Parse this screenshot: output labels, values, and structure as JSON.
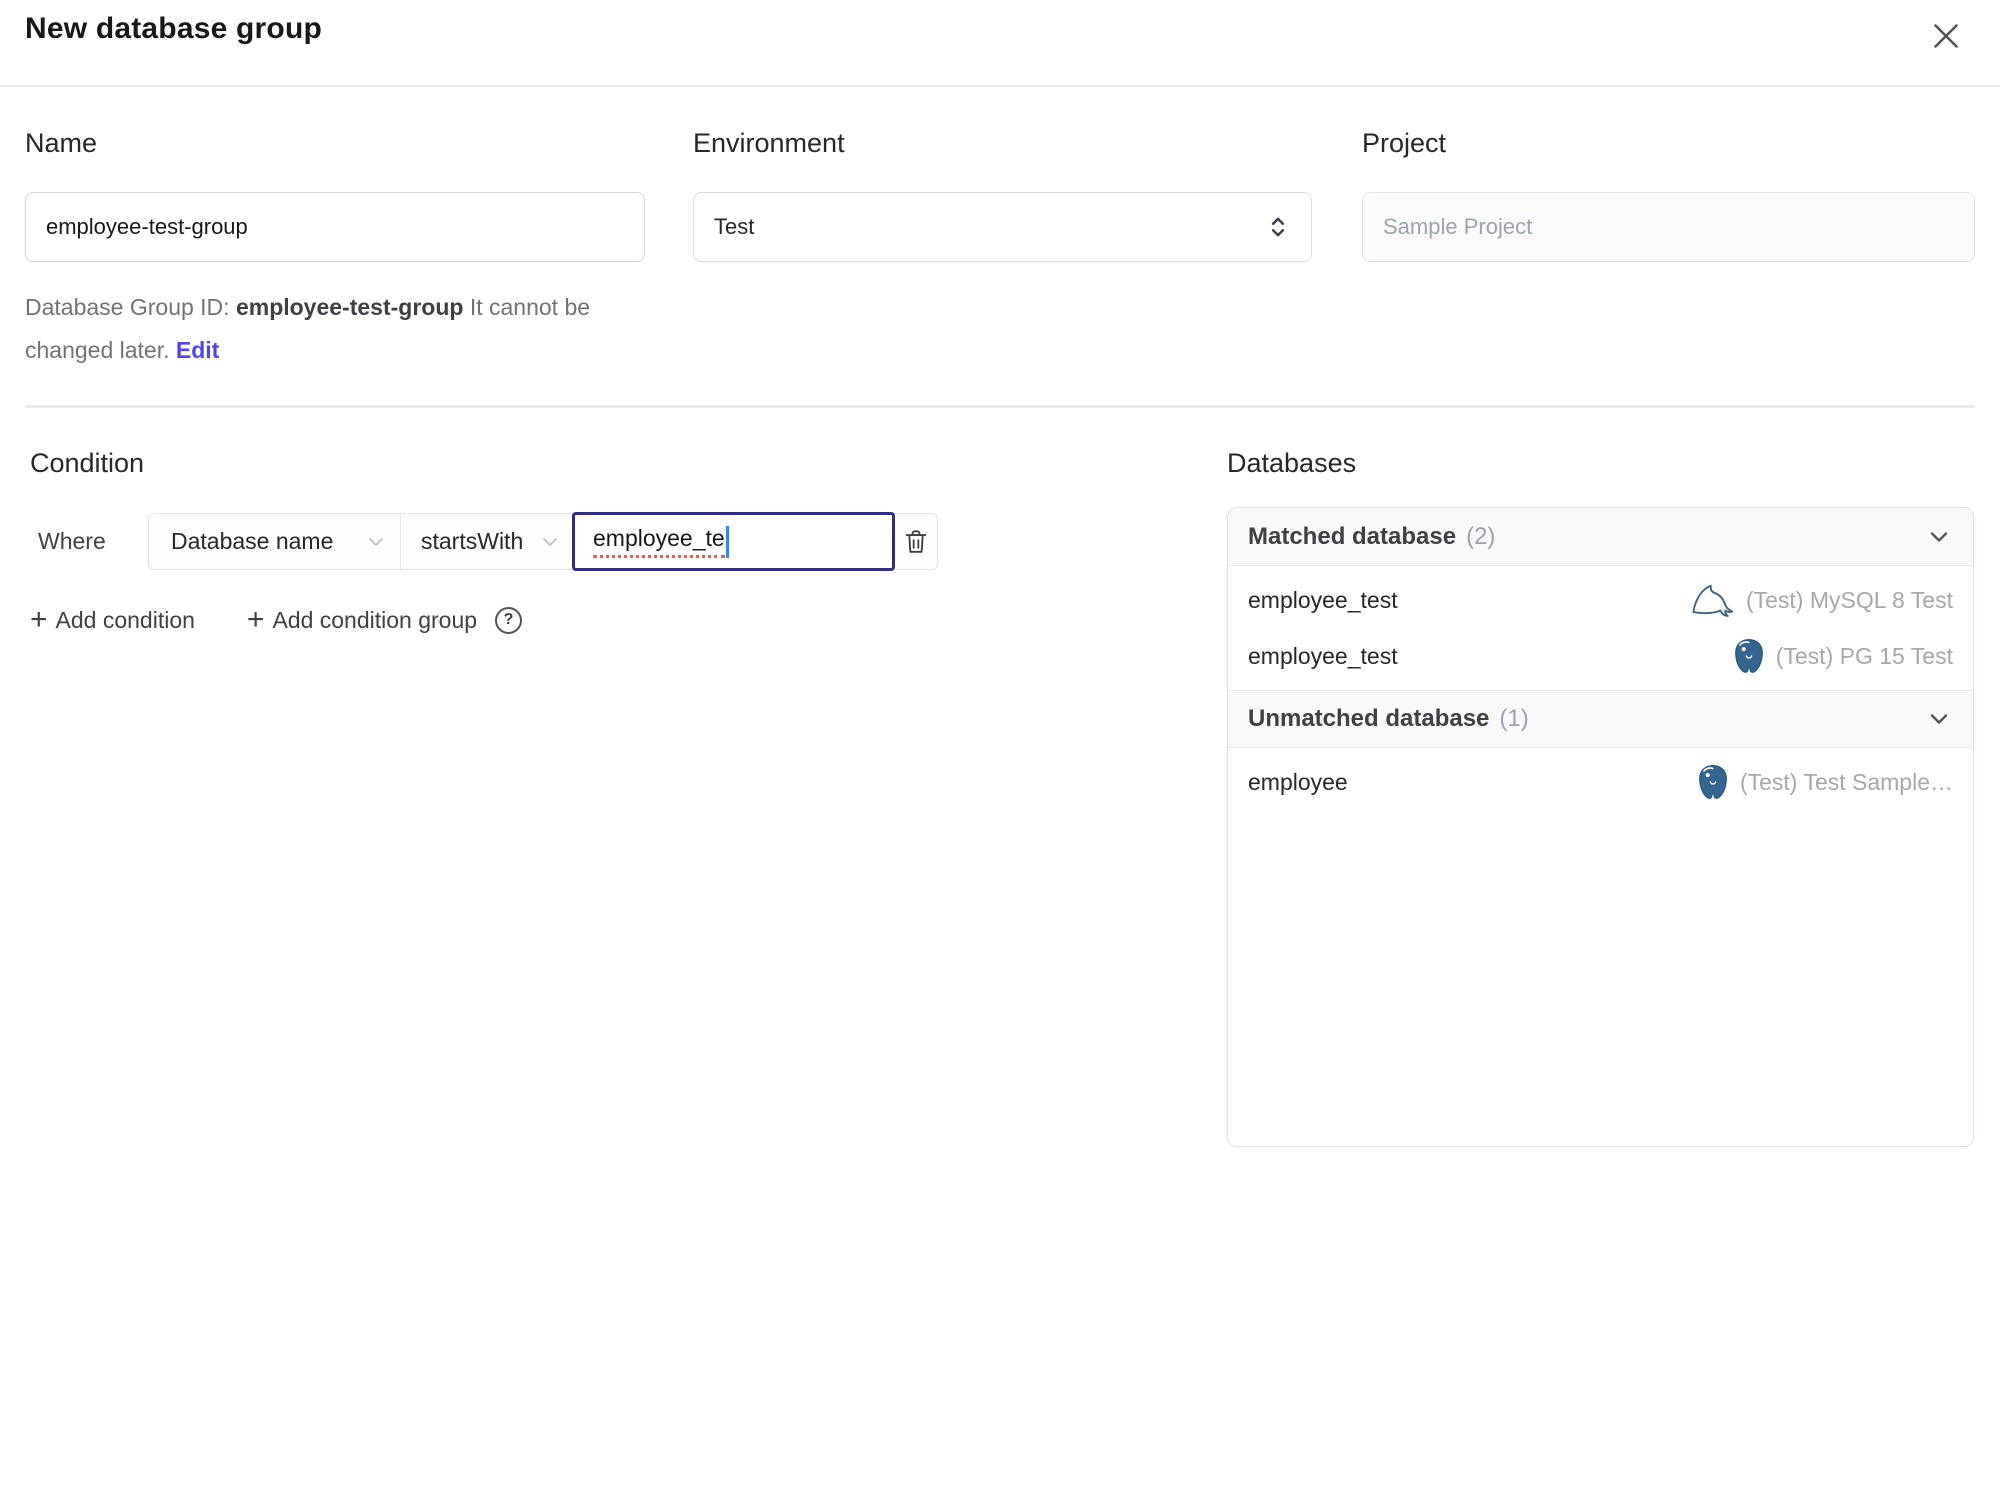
{
  "dialog": {
    "title": "New database group"
  },
  "form": {
    "name": {
      "label": "Name",
      "value": "employee-test-group"
    },
    "environment": {
      "label": "Environment",
      "value": "Test"
    },
    "project": {
      "label": "Project",
      "value": "Sample Project"
    },
    "id_note": {
      "prefix": "Database Group ID: ",
      "id": "employee-test-group",
      "suffix": " It cannot be changed later. ",
      "edit_label": "Edit"
    }
  },
  "condition": {
    "heading": "Condition",
    "where_label": "Where",
    "factor": "Database name",
    "operator": "startsWith",
    "value": "employee_te",
    "add_condition_label": "Add condition",
    "add_condition_group_label": "Add condition group"
  },
  "databases": {
    "heading": "Databases",
    "matched": {
      "title": "Matched database",
      "count": "(2)",
      "rows": [
        {
          "name": "employee_test",
          "engine_icon": "mysql-icon",
          "instance": "(Test) MySQL 8 Test"
        },
        {
          "name": "employee_test",
          "engine_icon": "postgres-icon",
          "instance": "(Test) PG 15 Test"
        }
      ]
    },
    "unmatched": {
      "title": "Unmatched database",
      "count": "(1)",
      "rows": [
        {
          "name": "employee",
          "engine_icon": "postgres-icon",
          "instance": "(Test) Test Sample…"
        }
      ]
    }
  },
  "icons": {
    "plus": "+",
    "help": "?"
  },
  "colors": {
    "accent": "#4f46e5",
    "focus_border": "#312e81",
    "mysql_icon": "#3f617d",
    "postgres_icon": "#336791",
    "header_bg": "#f8f9fa",
    "border": "#e4e4e7"
  }
}
